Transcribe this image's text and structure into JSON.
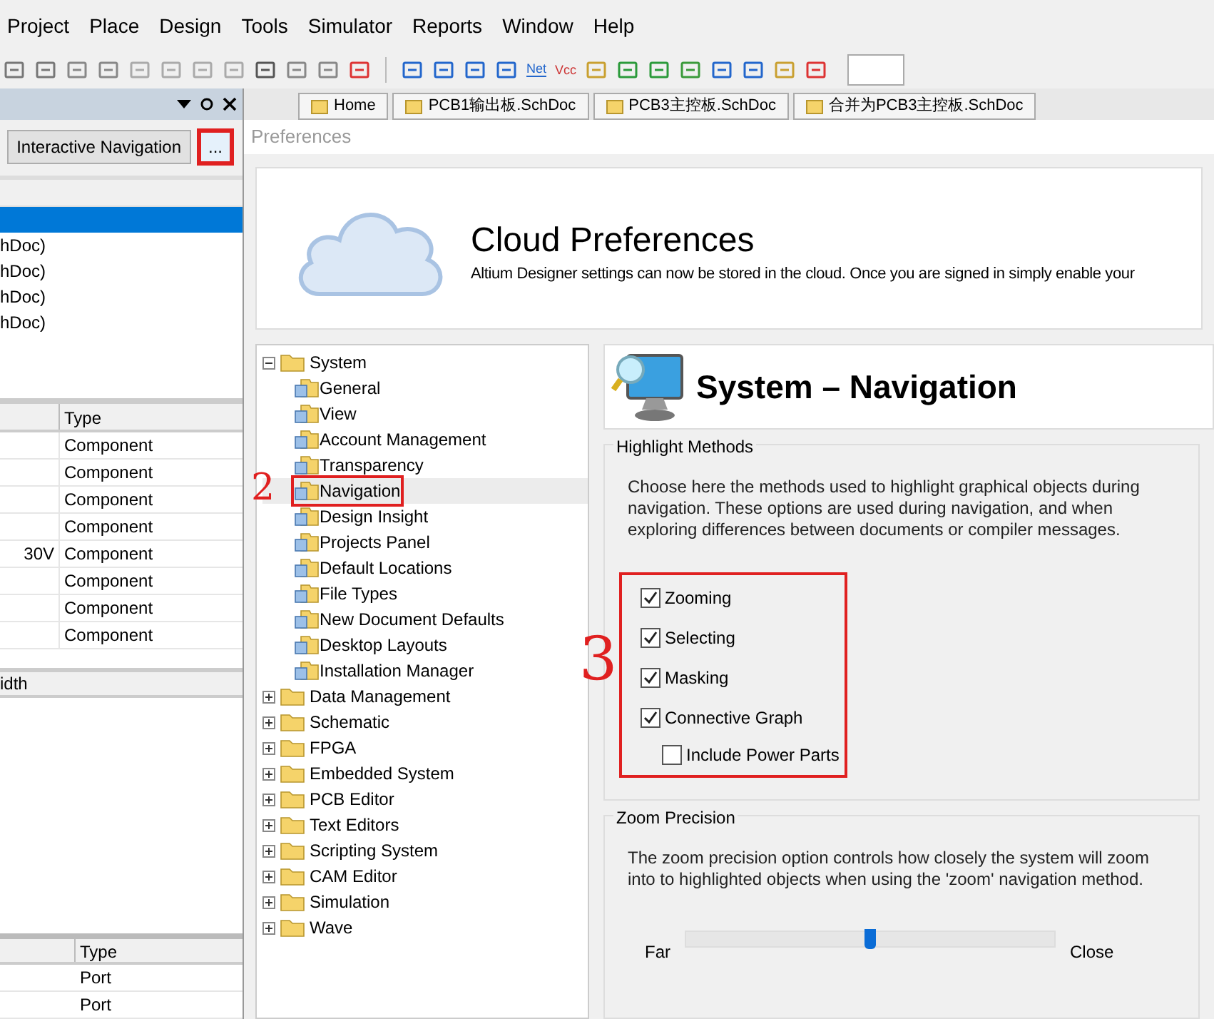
{
  "menu": [
    "Project",
    "Place",
    "Design",
    "Tools",
    "Simulator",
    "Reports",
    "Window",
    "Help"
  ],
  "toolbar": {
    "net_label": "Net",
    "power_label": "Vcc"
  },
  "left_panel": {
    "nav_button": "Interactive Navigation",
    "more_button": {
      "label": "...",
      "boxed": true
    },
    "documents": [
      {
        "selected": true
      },
      {
        "text": "hDoc)",
        "selected": false
      },
      {
        "text": "hDoc)",
        "selected": false
      },
      {
        "text": "hDoc)",
        "selected": false
      },
      {
        "text": "hDoc)",
        "selected": false
      }
    ],
    "components_table": {
      "column_2": "Type",
      "rows": [
        {
          "column_2": "Component"
        },
        {
          "column_2": "Component"
        },
        {
          "column_2": "Component"
        },
        {
          "column_2": "Component"
        },
        {
          "column_1": "30V",
          "column_2": "Component"
        },
        {
          "column_2": "Component"
        },
        {
          "column_2": "Component"
        },
        {
          "column_2": "Component"
        }
      ]
    },
    "nets_table": {
      "column_1": "idth"
    },
    "ports_table": {
      "column_2": "Type",
      "rows": [
        "Port",
        "Port"
      ]
    }
  },
  "tabs": [
    "Home",
    "PCB1输出板.SchDoc",
    "PCB3主控板.SchDoc",
    "合并为PCB3主控板.SchDoc"
  ],
  "dialog": {
    "title": "Preferences",
    "cloud": {
      "title": "Cloud Preferences",
      "text": "Altium Designer settings can now be stored in the cloud. Once you are signed in simply enable your"
    },
    "tree": [
      {
        "label": "System",
        "expanded": true,
        "selected": false,
        "children": [
          {
            "label": "General",
            "selected": false
          },
          {
            "label": "View",
            "selected": false
          },
          {
            "label": "Account Management",
            "selected": false
          },
          {
            "label": "Transparency",
            "selected": false
          },
          {
            "label": "Navigation",
            "selected": true,
            "annotation": "2"
          },
          {
            "label": "Design Insight",
            "selected": false
          },
          {
            "label": "Projects Panel",
            "selected": false
          },
          {
            "label": "Default Locations",
            "selected": false
          },
          {
            "label": "File Types",
            "selected": false
          },
          {
            "label": "New Document Defaults",
            "selected": false
          },
          {
            "label": "Desktop Layouts",
            "selected": false
          },
          {
            "label": "Installation Manager",
            "selected": false
          }
        ]
      },
      {
        "label": "Data Management",
        "expanded": false,
        "selected": false
      },
      {
        "label": "Schematic",
        "expanded": false,
        "selected": false
      },
      {
        "label": "FPGA",
        "expanded": false,
        "selected": false
      },
      {
        "label": "Embedded System",
        "expanded": false,
        "selected": false
      },
      {
        "label": "PCB Editor",
        "expanded": false,
        "selected": false
      },
      {
        "label": "Text Editors",
        "expanded": false,
        "selected": false
      },
      {
        "label": "Scripting System",
        "expanded": false,
        "selected": false
      },
      {
        "label": "CAM Editor",
        "expanded": false,
        "selected": false
      },
      {
        "label": "Simulation",
        "expanded": false,
        "selected": false
      },
      {
        "label": "Wave",
        "expanded": false,
        "selected": false
      }
    ],
    "page": {
      "title": "System – Navigation",
      "highlight": {
        "title": "Highlight Methods",
        "annotation": "3",
        "text": "Choose here the methods used to highlight graphical objects during navigation. These options are used during navigation, and when exploring differences between documents or compiler messages.",
        "options": [
          {
            "label": "Zooming",
            "checked": true
          },
          {
            "label": "Selecting",
            "checked": true
          },
          {
            "label": "Masking",
            "checked": true
          },
          {
            "label": "Connective Graph",
            "checked": true,
            "children": [
              {
                "label": "Include Power Parts",
                "checked": false
              }
            ]
          }
        ]
      },
      "zoom": {
        "title": "Zoom Precision",
        "text": "The zoom precision option controls how closely the system will zoom into to highlighted objects when using the 'zoom' navigation method.",
        "level": 0.5,
        "min_label": "Far",
        "max_label": "Close"
      }
    }
  }
}
